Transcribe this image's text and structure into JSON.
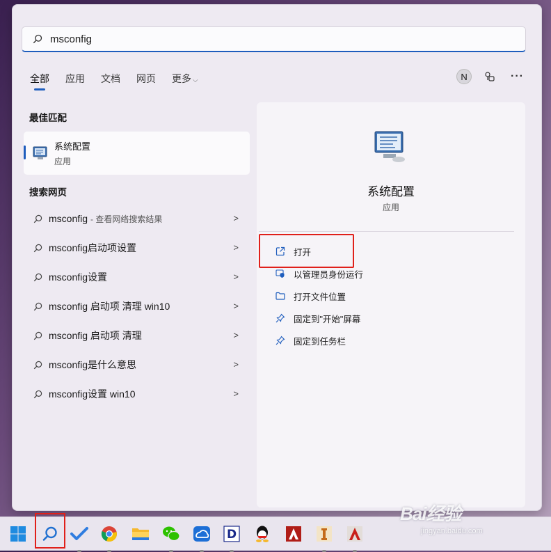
{
  "search": {
    "value": "msconfig"
  },
  "tabs": [
    {
      "label": "全部"
    },
    {
      "label": "应用"
    },
    {
      "label": "文档"
    },
    {
      "label": "网页"
    },
    {
      "label": "更多"
    }
  ],
  "avatar_letter": "N",
  "best_match": {
    "heading": "最佳匹配",
    "title": "系统配置",
    "subtitle": "应用"
  },
  "web": {
    "heading": "搜索网页",
    "items": [
      {
        "text": "msconfig",
        "hint": " - 查看网络搜索结果"
      },
      {
        "text": "msconfig启动项设置",
        "hint": ""
      },
      {
        "text": "msconfig设置",
        "hint": ""
      },
      {
        "text": "msconfig 启动项 清理 win10",
        "hint": ""
      },
      {
        "text": "msconfig 启动项 清理",
        "hint": ""
      },
      {
        "text": "msconfig是什么意思",
        "hint": ""
      },
      {
        "text": "msconfig设置 win10",
        "hint": ""
      }
    ]
  },
  "detail": {
    "title": "系统配置",
    "subtitle": "应用",
    "actions": [
      {
        "label": "打开",
        "icon": "open-external-icon"
      },
      {
        "label": "以管理员身份运行",
        "icon": "admin-shield-icon"
      },
      {
        "label": "打开文件位置",
        "icon": "folder-icon"
      },
      {
        "label": "固定到\"开始\"屏幕",
        "icon": "pin-icon"
      },
      {
        "label": "固定到任务栏",
        "icon": "pin-icon"
      }
    ]
  },
  "taskbar": {
    "apps": [
      "windows-start",
      "search",
      "todo",
      "chrome",
      "file-explorer",
      "wechat",
      "baidu-netdisk",
      "app-d",
      "qq",
      "autocad-red",
      "app-i",
      "autocad"
    ]
  },
  "watermark": {
    "brand": "Bai经验",
    "url": "jingyan.baidu.com"
  },
  "colors": {
    "accent": "#1e5dbd",
    "highlight": "#e0201a"
  }
}
